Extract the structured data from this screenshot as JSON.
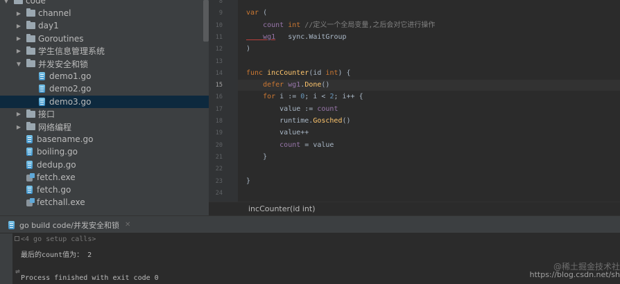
{
  "tree": {
    "items": [
      {
        "label": "code",
        "kind": "folder",
        "depth": 0,
        "arrow": "down"
      },
      {
        "label": "channel",
        "kind": "folder",
        "depth": 1,
        "arrow": "right"
      },
      {
        "label": "day1",
        "kind": "folder",
        "depth": 1,
        "arrow": "right"
      },
      {
        "label": "Goroutines",
        "kind": "folder",
        "depth": 1,
        "arrow": "right"
      },
      {
        "label": "学生信息管理系统",
        "kind": "folder",
        "depth": 1,
        "arrow": "right"
      },
      {
        "label": "并发安全和锁",
        "kind": "folder",
        "depth": 1,
        "arrow": "down"
      },
      {
        "label": "demo1.go",
        "kind": "go",
        "depth": 2
      },
      {
        "label": "demo2.go",
        "kind": "go",
        "depth": 2
      },
      {
        "label": "demo3.go",
        "kind": "go",
        "depth": 2,
        "selected": true
      },
      {
        "label": "接口",
        "kind": "folder",
        "depth": 1,
        "arrow": "right"
      },
      {
        "label": "网络编程",
        "kind": "folder",
        "depth": 1,
        "arrow": "right"
      },
      {
        "label": "basename.go",
        "kind": "go",
        "depth": 1
      },
      {
        "label": "boiling.go",
        "kind": "go",
        "depth": 1
      },
      {
        "label": "dedup.go",
        "kind": "go",
        "depth": 1
      },
      {
        "label": "fetch.exe",
        "kind": "exe",
        "depth": 1
      },
      {
        "label": "fetch.go",
        "kind": "go",
        "depth": 1
      },
      {
        "label": "fetchall.exe",
        "kind": "exe",
        "depth": 1
      }
    ]
  },
  "editor": {
    "lines": [
      {
        "n": "8",
        "tokens": []
      },
      {
        "n": "9",
        "fold": true,
        "tokens": [
          [
            "kw",
            "var"
          ],
          [
            "tp",
            " ("
          ]
        ]
      },
      {
        "n": "10",
        "tokens": [
          [
            "vr",
            "    count"
          ],
          [
            "tp",
            " "
          ],
          [
            "kw",
            "int"
          ],
          [
            "cm",
            " //定义一个全局变量,之后会对它进行操作"
          ]
        ]
      },
      {
        "n": "11",
        "tokens": [
          [
            "vrul",
            "    wg1"
          ],
          [
            "tp",
            "   sync.WaitGroup"
          ]
        ]
      },
      {
        "n": "12",
        "fold": true,
        "tokens": [
          [
            "tp",
            ")"
          ]
        ]
      },
      {
        "n": "13",
        "tokens": []
      },
      {
        "n": "14",
        "fold": true,
        "tokens": [
          [
            "kw",
            "func "
          ],
          [
            "fn",
            "incCounter"
          ],
          [
            "tp",
            "(id "
          ],
          [
            "kw",
            "int"
          ],
          [
            "tp",
            ") {"
          ]
        ]
      },
      {
        "n": "15",
        "current": true,
        "tokens": [
          [
            "kw",
            "    defer "
          ],
          [
            "vr",
            "wg1"
          ],
          [
            "tp",
            "."
          ],
          [
            "fn",
            "Done"
          ],
          [
            "tp",
            "()"
          ]
        ]
      },
      {
        "n": "16",
        "fold": true,
        "tokens": [
          [
            "kw",
            "    for "
          ],
          [
            "tp",
            "i := "
          ],
          [
            "nm",
            "0"
          ],
          [
            "tp",
            "; i < "
          ],
          [
            "nm",
            "2"
          ],
          [
            "tp",
            "; i++ {"
          ]
        ]
      },
      {
        "n": "17",
        "tokens": [
          [
            "tp",
            "        value := "
          ],
          [
            "vr",
            "count"
          ]
        ]
      },
      {
        "n": "18",
        "tokens": [
          [
            "tp",
            "        runtime."
          ],
          [
            "fn",
            "Gosched"
          ],
          [
            "tp",
            "()"
          ]
        ]
      },
      {
        "n": "19",
        "tokens": [
          [
            "tp",
            "        value++"
          ]
        ]
      },
      {
        "n": "20",
        "tokens": [
          [
            "vr",
            "        count"
          ],
          [
            "tp",
            " = value"
          ]
        ]
      },
      {
        "n": "21",
        "fold": true,
        "tokens": [
          [
            "tp",
            "    }"
          ]
        ]
      },
      {
        "n": "22",
        "tokens": []
      },
      {
        "n": "23",
        "fold": true,
        "tokens": [
          [
            "tp",
            "}"
          ]
        ]
      },
      {
        "n": "24",
        "tokens": []
      }
    ],
    "breadcrumb": "incCounter(id int)"
  },
  "run": {
    "tab_label": "go build code/并发安全和锁",
    "lines": [
      {
        "text": "<4 go setup calls>",
        "dim": true
      },
      {
        "text": "最后的count值为： 2",
        "dim": false
      },
      {
        "text": "",
        "dim": false
      },
      {
        "text": "Process finished with exit code 0",
        "dim": false
      }
    ]
  },
  "watermark": {
    "line1": "@稀土掘金技术社",
    "line2": "https://blog.csdn.net/sh"
  },
  "colors": {
    "tree_bg": "#3c3f41",
    "editor_bg": "#2b2b2b",
    "selection": "#0d293e",
    "keyword": "#cc7832",
    "function": "#ffc66d",
    "variable": "#9876aa",
    "comment": "#808080",
    "number": "#6897bb"
  }
}
